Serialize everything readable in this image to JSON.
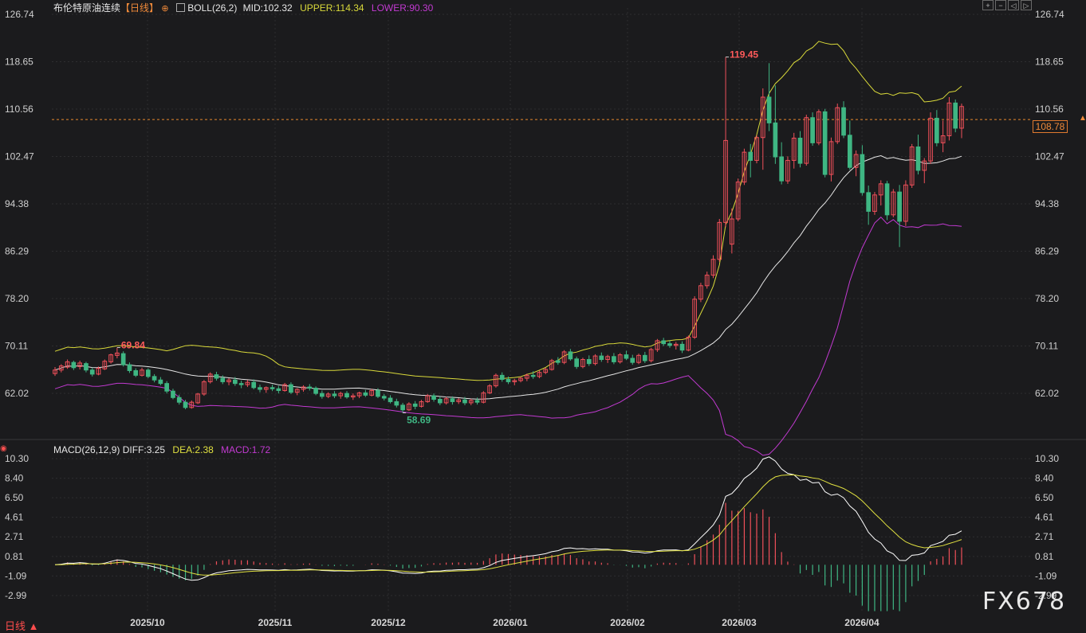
{
  "header": {
    "symbol": "布伦特原油连续",
    "period": "【日线】",
    "boll_label": "BOLL(26,2)",
    "mid": "MID:102.32",
    "upper": "UPPER:114.34",
    "lower": "LOWER:90.30",
    "toolbar_icons": [
      "zoom-in-icon",
      "zoom-out-icon",
      "move-left-icon",
      "move-right-icon"
    ]
  },
  "macd_header": {
    "label": "MACD(26,12,9)",
    "diff": "DIFF:3.25",
    "dea": "DEA:2.38",
    "macd": "MACD:1.72"
  },
  "price_axis": [
    "126.74",
    "118.65",
    "110.56",
    "102.47",
    "94.38",
    "86.29",
    "78.20",
    "70.11",
    "62.02"
  ],
  "macd_axis": [
    "10.30",
    "8.40",
    "6.50",
    "4.61",
    "2.71",
    "0.81",
    "-1.09",
    "-2.99"
  ],
  "x_axis": [
    "2025/10",
    "2025/11",
    "2025/12",
    "2026/01",
    "2026/02",
    "2026/03",
    "2026/04"
  ],
  "annotations": {
    "high": "119.45",
    "mid_high": "69.84",
    "low": "58.69"
  },
  "current_price": "108.78",
  "timeframe_label": "日线 ▲",
  "watermark": "FX678",
  "colors": {
    "up": "#f0505a",
    "down": "#3fb683",
    "mid": "#e6e6e6",
    "upper": "#d9d93a",
    "lower": "#c23ad1",
    "diff": "#ffffff",
    "dea": "#e0e040",
    "grid": "#2e2e30",
    "price_line": "#e88a2e"
  },
  "chart_data": {
    "type": "candlestick",
    "ohlc": [
      [
        65.4,
        66.5,
        65.0,
        66.0
      ],
      [
        66.0,
        67.0,
        65.6,
        66.7
      ],
      [
        66.5,
        67.8,
        66.2,
        67.4
      ],
      [
        67.3,
        67.6,
        66.0,
        66.4
      ],
      [
        66.6,
        67.6,
        66.1,
        67.2
      ],
      [
        67.1,
        67.4,
        65.6,
        66.0
      ],
      [
        66.0,
        66.4,
        64.9,
        65.3
      ],
      [
        65.3,
        66.6,
        65.1,
        66.3
      ],
      [
        66.2,
        67.8,
        66.0,
        67.5
      ],
      [
        67.4,
        68.8,
        67.1,
        68.6
      ],
      [
        68.5,
        69.84,
        68.0,
        68.9
      ],
      [
        68.8,
        69.2,
        66.6,
        66.9
      ],
      [
        66.9,
        67.3,
        65.5,
        65.9
      ],
      [
        65.9,
        66.3,
        64.8,
        65.1
      ],
      [
        65.1,
        66.4,
        64.9,
        66.0
      ],
      [
        66.0,
        66.3,
        64.6,
        64.9
      ],
      [
        64.9,
        65.3,
        63.9,
        64.3
      ],
      [
        64.3,
        64.8,
        63.4,
        63.7
      ],
      [
        63.7,
        64.1,
        62.0,
        62.4
      ],
      [
        62.4,
        62.8,
        61.0,
        61.3
      ],
      [
        61.3,
        61.8,
        60.1,
        60.5
      ],
      [
        60.5,
        60.9,
        59.3,
        59.6
      ],
      [
        59.6,
        60.8,
        59.4,
        60.5
      ],
      [
        60.4,
        62.1,
        60.2,
        61.9
      ],
      [
        61.9,
        64.3,
        61.6,
        64.0
      ],
      [
        64.0,
        65.6,
        63.7,
        65.3
      ],
      [
        65.2,
        65.7,
        64.2,
        64.6
      ],
      [
        64.6,
        65.1,
        63.6,
        64.0
      ],
      [
        64.0,
        64.6,
        63.4,
        64.3
      ],
      [
        64.3,
        64.8,
        63.3,
        63.7
      ],
      [
        63.7,
        64.2,
        62.9,
        63.5
      ],
      [
        63.5,
        64.3,
        63.1,
        63.9
      ],
      [
        63.9,
        64.4,
        62.7,
        63.0
      ],
      [
        63.0,
        63.5,
        62.2,
        62.7
      ],
      [
        62.7,
        63.2,
        62.1,
        63.0
      ],
      [
        63.0,
        63.5,
        62.4,
        62.8
      ],
      [
        62.8,
        63.3,
        62.0,
        62.5
      ],
      [
        62.5,
        63.8,
        62.3,
        63.5
      ],
      [
        63.5,
        63.9,
        61.9,
        62.2
      ],
      [
        62.2,
        62.9,
        61.7,
        62.7
      ],
      [
        62.7,
        63.4,
        62.3,
        63.1
      ],
      [
        63.1,
        63.6,
        62.5,
        62.9
      ],
      [
        62.9,
        63.2,
        61.7,
        62.0
      ],
      [
        62.0,
        62.5,
        61.1,
        61.5
      ],
      [
        61.5,
        62.2,
        61.2,
        61.9
      ],
      [
        61.9,
        62.4,
        61.2,
        61.6
      ],
      [
        61.6,
        62.3,
        61.1,
        62.0
      ],
      [
        62.0,
        62.4,
        61.1,
        61.4
      ],
      [
        61.4,
        62.0,
        60.9,
        61.6
      ],
      [
        61.6,
        62.3,
        61.2,
        62.1
      ],
      [
        62.1,
        62.6,
        61.4,
        61.7
      ],
      [
        61.7,
        62.8,
        61.5,
        62.5
      ],
      [
        62.5,
        62.9,
        61.2,
        61.5
      ],
      [
        61.5,
        61.9,
        60.8,
        61.2
      ],
      [
        61.2,
        61.7,
        60.3,
        60.6
      ],
      [
        60.6,
        61.1,
        59.6,
        60.0
      ],
      [
        60.0,
        60.4,
        58.69,
        59.2
      ],
      [
        59.2,
        60.5,
        59.0,
        60.2
      ],
      [
        60.2,
        60.7,
        59.3,
        59.8
      ],
      [
        59.8,
        60.9,
        59.6,
        60.6
      ],
      [
        60.6,
        61.9,
        60.4,
        61.6
      ],
      [
        61.6,
        62.0,
        60.6,
        61.0
      ],
      [
        61.0,
        61.5,
        60.0,
        60.4
      ],
      [
        60.4,
        61.4,
        60.1,
        61.1
      ],
      [
        61.1,
        61.5,
        60.1,
        60.6
      ],
      [
        60.6,
        61.2,
        60.2,
        60.9
      ],
      [
        60.9,
        61.4,
        60.0,
        60.4
      ],
      [
        60.4,
        61.1,
        60.0,
        60.8
      ],
      [
        60.8,
        61.3,
        60.1,
        60.5
      ],
      [
        60.5,
        62.4,
        60.3,
        62.1
      ],
      [
        62.1,
        63.6,
        61.9,
        63.3
      ],
      [
        63.3,
        65.4,
        63.0,
        65.1
      ],
      [
        65.1,
        65.6,
        64.0,
        64.4
      ],
      [
        64.4,
        64.9,
        63.6,
        64.0
      ],
      [
        64.0,
        64.5,
        63.4,
        64.2
      ],
      [
        64.2,
        64.8,
        63.9,
        64.6
      ],
      [
        64.6,
        65.4,
        64.1,
        65.1
      ],
      [
        65.1,
        65.8,
        64.5,
        64.9
      ],
      [
        64.9,
        65.9,
        64.6,
        65.6
      ],
      [
        65.6,
        66.4,
        65.3,
        66.1
      ],
      [
        66.1,
        67.9,
        65.9,
        67.6
      ],
      [
        67.6,
        68.2,
        66.9,
        67.3
      ],
      [
        67.3,
        69.4,
        67.0,
        69.1
      ],
      [
        69.1,
        69.6,
        67.6,
        67.9
      ],
      [
        67.9,
        68.3,
        66.2,
        66.6
      ],
      [
        66.6,
        68.1,
        66.3,
        67.8
      ],
      [
        67.8,
        68.5,
        66.7,
        67.1
      ],
      [
        67.1,
        68.7,
        66.8,
        68.4
      ],
      [
        68.4,
        69.0,
        67.4,
        67.8
      ],
      [
        67.8,
        68.6,
        67.2,
        68.3
      ],
      [
        68.3,
        68.9,
        67.0,
        67.4
      ],
      [
        67.4,
        68.9,
        67.1,
        68.6
      ],
      [
        68.6,
        69.3,
        67.7,
        68.0
      ],
      [
        68.0,
        68.6,
        66.9,
        67.3
      ],
      [
        67.3,
        68.8,
        67.0,
        68.5
      ],
      [
        68.5,
        69.1,
        67.2,
        67.6
      ],
      [
        67.6,
        69.8,
        67.3,
        69.5
      ],
      [
        69.5,
        71.3,
        69.1,
        71.0
      ],
      [
        71.0,
        71.5,
        70.1,
        70.5
      ],
      [
        70.5,
        71.1,
        69.8,
        70.2
      ],
      [
        70.2,
        70.8,
        69.5,
        70.4
      ],
      [
        70.4,
        70.9,
        68.9,
        69.4
      ],
      [
        69.4,
        71.9,
        69.2,
        71.6
      ],
      [
        71.6,
        78.6,
        71.3,
        78.1
      ],
      [
        78.1,
        80.9,
        77.6,
        80.4
      ],
      [
        80.4,
        82.8,
        79.9,
        82.2
      ],
      [
        82.2,
        85.6,
        81.7,
        84.9
      ],
      [
        84.9,
        91.8,
        84.5,
        91.2
      ],
      [
        91.2,
        119.45,
        90.4,
        105.2
      ],
      [
        87.5,
        93.6,
        85.9,
        91.8
      ],
      [
        91.8,
        98.7,
        91.4,
        98.1
      ],
      [
        98.1,
        103.8,
        97.6,
        103.2
      ],
      [
        103.2,
        104.6,
        98.9,
        101.8
      ],
      [
        101.8,
        106.1,
        101.3,
        105.7
      ],
      [
        105.7,
        114.1,
        100.2,
        112.6
      ],
      [
        112.6,
        118.4,
        106.8,
        108.2
      ],
      [
        108.2,
        114.6,
        101.2,
        102.4
      ],
      [
        102.4,
        104.9,
        97.7,
        98.3
      ],
      [
        98.3,
        102.5,
        97.8,
        101.8
      ],
      [
        101.8,
        106.5,
        100.4,
        105.6
      ],
      [
        105.6,
        106.8,
        100.6,
        101.3
      ],
      [
        101.3,
        109.6,
        100.9,
        109.1
      ],
      [
        109.1,
        110.0,
        104.3,
        104.8
      ],
      [
        104.8,
        110.5,
        104.4,
        110.1
      ],
      [
        110.1,
        110.6,
        98.9,
        99.4
      ],
      [
        99.4,
        105.7,
        98.2,
        105.0
      ],
      [
        105.0,
        111.5,
        104.6,
        110.8
      ],
      [
        110.8,
        111.9,
        105.6,
        106.1
      ],
      [
        106.1,
        108.6,
        100.2,
        100.6
      ],
      [
        100.6,
        103.5,
        99.1,
        102.8
      ],
      [
        102.8,
        104.4,
        95.8,
        96.3
      ],
      [
        96.3,
        97.5,
        90.8,
        93.1
      ],
      [
        93.1,
        96.4,
        92.5,
        95.9
      ],
      [
        95.9,
        98.4,
        94.1,
        97.8
      ],
      [
        97.8,
        98.3,
        91.6,
        92.5
      ],
      [
        92.5,
        96.9,
        92.1,
        96.4
      ],
      [
        96.4,
        97.6,
        87.0,
        91.4
      ],
      [
        91.4,
        98.4,
        90.6,
        97.6
      ],
      [
        97.6,
        104.6,
        97.1,
        104.1
      ],
      [
        104.1,
        106.2,
        99.4,
        100.1
      ],
      [
        100.1,
        102.2,
        97.9,
        101.7
      ],
      [
        101.7,
        110.0,
        101.2,
        109.0
      ],
      [
        109.0,
        110.4,
        104.2,
        104.8
      ],
      [
        104.8,
        108.6,
        103.2,
        106.0
      ],
      [
        106.0,
        112.6,
        105.2,
        111.6
      ],
      [
        111.6,
        112.2,
        106.6,
        107.3
      ],
      [
        107.3,
        111.5,
        105.6,
        111.0
      ]
    ],
    "x_labels": [
      "2025/10",
      "2025/11",
      "2025/12",
      "2026/01",
      "2026/02",
      "2026/03",
      "2026/04"
    ],
    "boll": {
      "mid": 102.32,
      "upper": 114.34,
      "lower": 90.3
    },
    "macd": {
      "diff": 3.25,
      "dea": 2.38,
      "macd": 1.72
    },
    "y_range": [
      58.0,
      126.74
    ],
    "macd_range": [
      -4.5,
      10.3
    ]
  }
}
